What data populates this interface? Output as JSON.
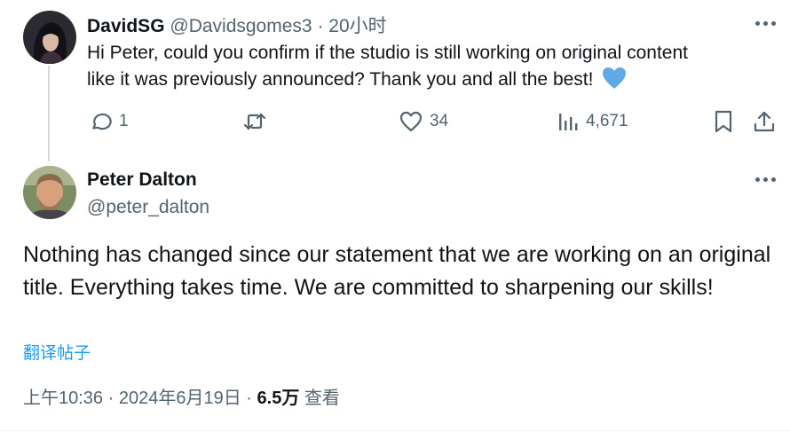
{
  "reply_tweet": {
    "display_name": "DavidSG",
    "handle": "@Davidsgomes3",
    "separator": "·",
    "time": "20小时",
    "text_line1": "Hi Peter, could you confirm if the studio is still working on original content",
    "text_line2": "like it was previously announced? Thank you and all the best!",
    "emoji": "blue-heart",
    "actions": {
      "replies": "1",
      "retweets": "",
      "likes": "34",
      "views": "4,671"
    }
  },
  "main_tweet": {
    "display_name": "Peter Dalton",
    "handle": "@peter_dalton",
    "text": "Nothing has changed since our statement that we are working on an original title. Everything takes time. We are committed to sharpening our skills!",
    "translate_label": "翻译帖子",
    "time": "上午10:36",
    "separator": "·",
    "date": "2024年6月19日",
    "views_count": "6.5万",
    "views_label": "查看"
  },
  "icons": {
    "reply": "reply-icon",
    "retweet": "retweet-icon",
    "like": "heart-icon",
    "views": "views-icon",
    "bookmark": "bookmark-icon",
    "share": "share-icon",
    "more": "more-icon"
  },
  "colors": {
    "text": "#0f1419",
    "muted": "#536471",
    "link": "#1d9bf0",
    "thread_line": "#cfd9de",
    "heart": "#5ea9e6"
  }
}
